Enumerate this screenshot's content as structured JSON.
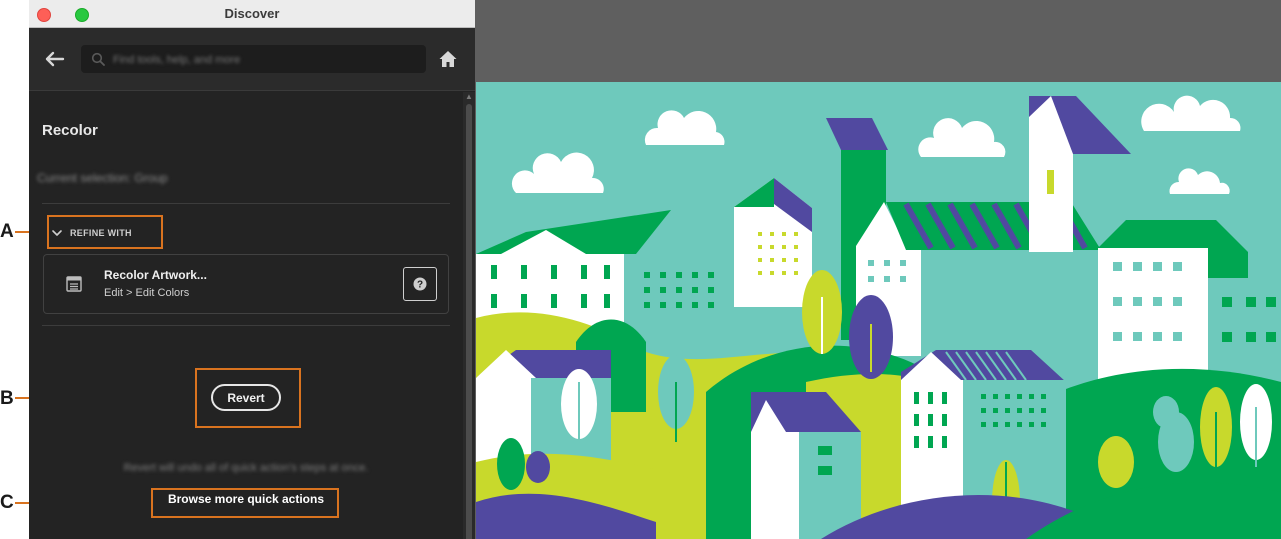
{
  "window": {
    "title": "Discover"
  },
  "navbar": {
    "back_icon": "arrow-left-icon",
    "search_placeholder": "Find tools, help, and more",
    "home_icon": "home-icon"
  },
  "panel": {
    "section_title": "Recolor",
    "context_text": "Current selection: Group",
    "refine": {
      "label": "REFINE WITH",
      "chevron_icon": "chevron-down-icon"
    },
    "action_card": {
      "icon": "artwork-icon",
      "title": "Recolor Artwork...",
      "path": "Edit > Edit Colors",
      "help_icon": "question-icon"
    },
    "revert_label": "Revert",
    "revert_note": "Revert will undo all of quick action's steps at once.",
    "browse_label": "Browse more quick actions"
  },
  "callouts": [
    {
      "letter": "A"
    },
    {
      "letter": "B"
    },
    {
      "letter": "C"
    }
  ],
  "colors": {
    "callout": "#d9731f",
    "panel_bg": "#232323",
    "sky": "#6ec9bc",
    "green": "#00a651",
    "lime": "#c8d92c",
    "purple": "#5149a0",
    "white": "#ffffff",
    "canvas": "#5f5f5f"
  }
}
